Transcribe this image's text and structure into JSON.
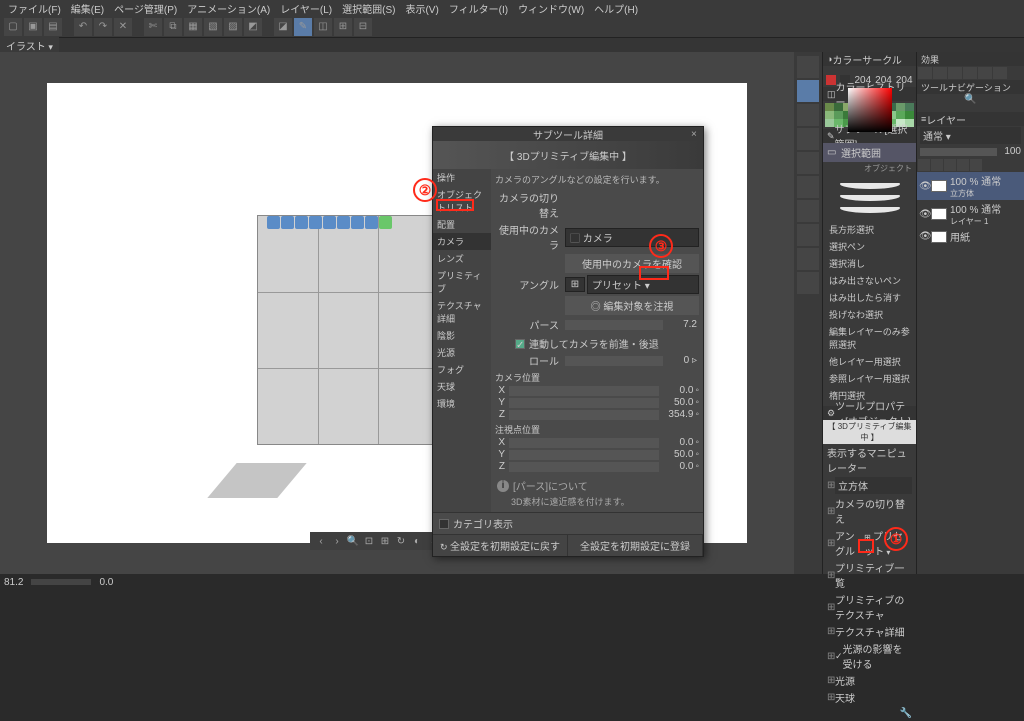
{
  "menu": [
    "ファイル(F)",
    "編集(E)",
    "ページ管理(P)",
    "アニメーション(A)",
    "レイヤー(L)",
    "選択範囲(S)",
    "表示(V)",
    "フィルター(I)",
    "ウィンドウ(W)",
    "ヘルプ(H)"
  ],
  "doc_tab": "イラスト",
  "subtool_panel": {
    "title": "サブツール詳細",
    "banner": "【 3Dプリミティブ編集中 】",
    "categories": [
      "操作",
      "オブジェクトリスト",
      "配置",
      "カメラ",
      "レンズ",
      "プリミティブ",
      "テクスチャ詳細",
      "陰影",
      "光源",
      "フォグ",
      "天球",
      "環境"
    ],
    "selected_category": "カメラ",
    "description": "カメラのアングルなどの設定を行います。",
    "camera_switch_label": "カメラの切り替え",
    "current_camera_label": "使用中のカメラ",
    "current_camera_value": "カメラ",
    "confirm_camera_btn": "使用中のカメラを確認",
    "angle_label": "アングル",
    "angle_preset": "プリセット",
    "focus_edit_btn": "編集対象を注視",
    "perspective_label": "パース",
    "perspective_value": "7.2",
    "move_camera_checkbox": "連動してカメラを前進・後退",
    "roll_label": "ロール",
    "roll_value": "0",
    "camera_pos_label": "カメラ位置",
    "pos": {
      "X": "0.0",
      "Y": "50.0",
      "Z": "354.9"
    },
    "look_at_label": "注視点位置",
    "look": {
      "X": "0.0",
      "Y": "50.0",
      "Z": "0.0"
    },
    "info_title": "[パース]について",
    "info_desc": "3D素材に遠近感を付けます。",
    "category_display": "カテゴリ表示",
    "footer_reset_all": "全設定を初期設定に戻す",
    "footer_register": "全設定を初期設定に登録"
  },
  "right": {
    "color_circle_title": "カラーサークル",
    "rgb": {
      "r": "204",
      "g": "204",
      "b": "204"
    },
    "color_history_title": "カラーヒストリー",
    "subtool_title": "サブツール[選択範囲]",
    "subtool_group": "選択範囲",
    "object_label": "オブジェクト",
    "subtools": [
      "長方形選択",
      "選択ペン",
      "選択消し",
      "はみ出さないペン",
      "はみ出したら消す",
      "投げなわ選択",
      "編集レイヤーのみ参照選択",
      "他レイヤー用選択",
      "参照レイヤー用選択",
      "楕円選択"
    ],
    "tool_prop_title": "ツールプロパティ[オブジェクト]",
    "tool_prop_banner": "【 3Dプリミティブ編集中 】",
    "manipulator_label": "表示するマニピュレーター",
    "primitive_shape": "立方体",
    "props": [
      "カメラの切り替え",
      "アングル",
      "プリミティブ一覧",
      "プリミティブのテクスチャ",
      "テクスチャ詳細",
      "光源の影響を受ける",
      "光源",
      "天球"
    ],
    "angle_preset": "プリセット",
    "effects_title": "効果",
    "navigator_title": "ツールナビゲーション",
    "layer_title": "レイヤー",
    "layer_mode": "通常",
    "layer_opacity": "100",
    "layers": [
      {
        "name": "100 % 通常",
        "sub": "立方体"
      },
      {
        "name": "100 % 通常",
        "sub": "レイヤー 1"
      },
      {
        "name": "用紙",
        "sub": ""
      }
    ]
  },
  "status": {
    "zoom": "81.2",
    "pos": "0.0"
  },
  "annotations": {
    "a1": "①",
    "a2": "②",
    "a3": "③"
  }
}
